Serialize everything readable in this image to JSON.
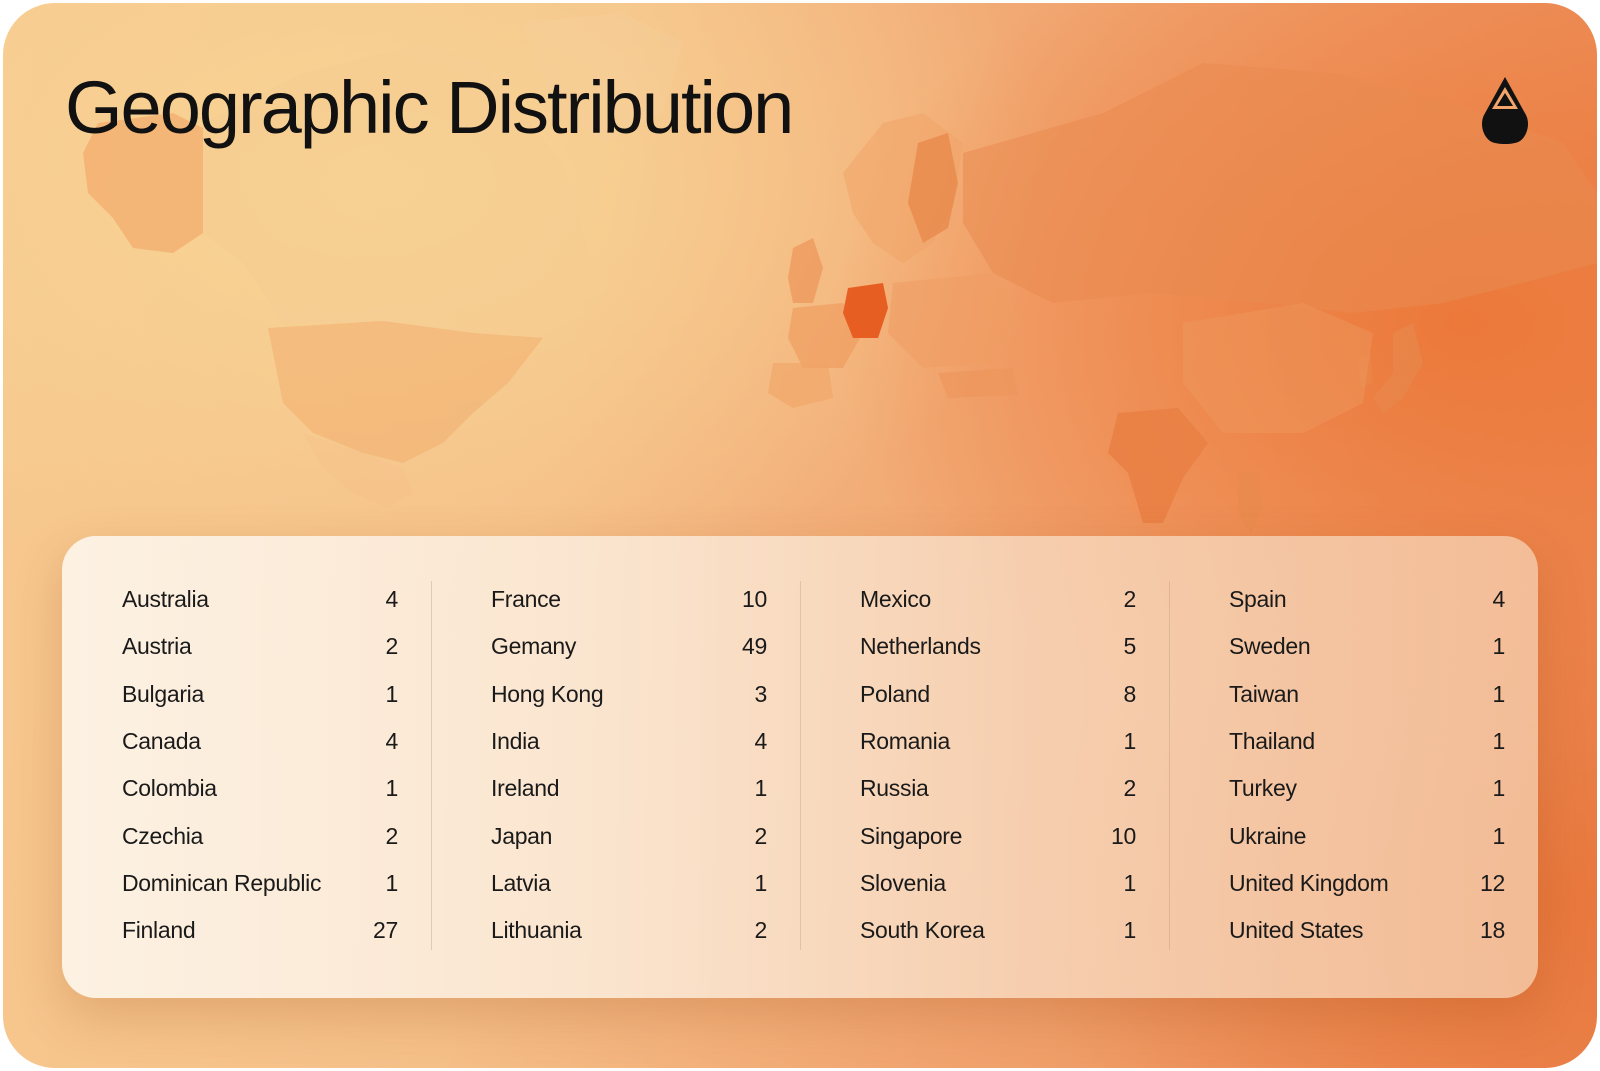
{
  "title": "Geographic Distribution",
  "logo": {
    "icon": "drop-logo-icon"
  },
  "colors": {
    "accent": "#e8622a",
    "highlight": "#e65a1f",
    "text": "#111111"
  },
  "columns": [
    [
      {
        "country": "Australia",
        "count": "4"
      },
      {
        "country": "Austria",
        "count": "2"
      },
      {
        "country": "Bulgaria",
        "count": "1"
      },
      {
        "country": "Canada",
        "count": "4"
      },
      {
        "country": "Colombia",
        "count": "1"
      },
      {
        "country": "Czechia",
        "count": "2"
      },
      {
        "country": "Dominican Republic",
        "count": "1"
      },
      {
        "country": "Finland",
        "count": "27"
      }
    ],
    [
      {
        "country": "France",
        "count": "10"
      },
      {
        "country": "Gemany",
        "count": "49"
      },
      {
        "country": "Hong Kong",
        "count": "3"
      },
      {
        "country": "India",
        "count": "4"
      },
      {
        "country": "Ireland",
        "count": "1"
      },
      {
        "country": "Japan",
        "count": "2"
      },
      {
        "country": "Latvia",
        "count": "1"
      },
      {
        "country": "Lithuania",
        "count": "2"
      }
    ],
    [
      {
        "country": "Mexico",
        "count": "2"
      },
      {
        "country": "Netherlands",
        "count": "5"
      },
      {
        "country": "Poland",
        "count": "8"
      },
      {
        "country": "Romania",
        "count": "1"
      },
      {
        "country": "Russia",
        "count": "2"
      },
      {
        "country": "Singapore",
        "count": "10"
      },
      {
        "country": "Slovenia",
        "count": "1"
      },
      {
        "country": "South Korea",
        "count": "1"
      }
    ],
    [
      {
        "country": "Spain",
        "count": "4"
      },
      {
        "country": "Sweden",
        "count": "1"
      },
      {
        "country": "Taiwan",
        "count": "1"
      },
      {
        "country": "Thailand",
        "count": "1"
      },
      {
        "country": "Turkey",
        "count": "1"
      },
      {
        "country": "Ukraine",
        "count": "1"
      },
      {
        "country": "United Kingdom",
        "count": "12"
      },
      {
        "country": "United States",
        "count": "18"
      }
    ]
  ]
}
